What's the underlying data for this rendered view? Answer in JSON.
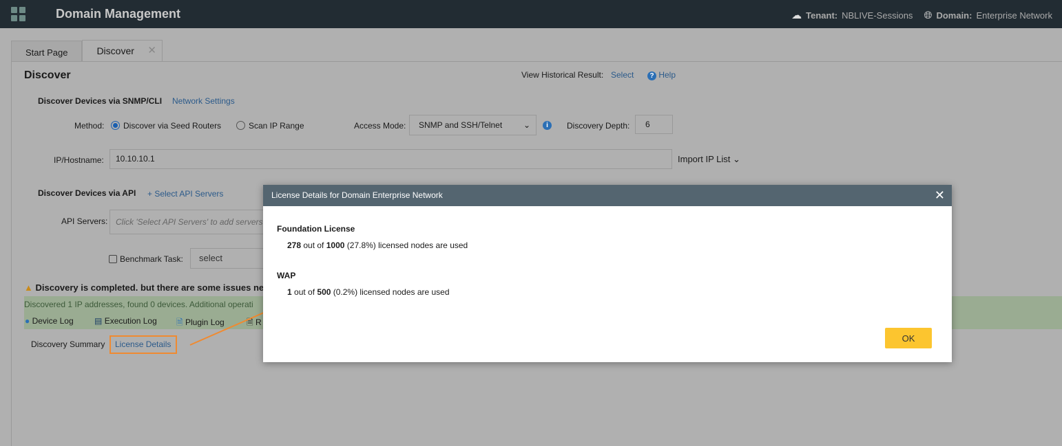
{
  "header": {
    "title": "Domain Management",
    "tenant_label": "Tenant:",
    "tenant": "NBLIVE-Sessions",
    "domain_label": "Domain:",
    "domain": "Enterprise Network"
  },
  "tabs": [
    {
      "label": "Start Page"
    },
    {
      "label": "Discover"
    }
  ],
  "page": {
    "title": "Discover",
    "view_hist": "View Historical Result:",
    "select": "Select",
    "help": "Help"
  },
  "snmp": {
    "title": "Discover Devices via SNMP/CLI",
    "network_settings": "Network Settings",
    "method_label": "Method:",
    "opt1": "Discover via Seed Routers",
    "opt2": "Scan IP Range",
    "access_label": "Access Mode:",
    "access_value": "SNMP and SSH/Telnet",
    "depth_label": "Discovery Depth:",
    "depth_value": "6",
    "ip_label": "IP/Hostname:",
    "ip_value": "10.10.10.1",
    "import": "Import IP List"
  },
  "api": {
    "title": "Discover Devices via API",
    "select_servers": "+ Select API Servers",
    "servers_label": "API Servers:",
    "servers_placeholder": "Click 'Select API Servers' to add servers.",
    "benchmark_label": "Benchmark Task:",
    "benchmark_value": "select"
  },
  "status": {
    "warning": "Discovery is completed. but there are some issues need",
    "summary": "Discovered 1 IP addresses, found 0 devices.  Additional operati",
    "logs": [
      "Device Log",
      "Execution Log",
      "Plugin Log",
      "R"
    ],
    "discovery_summary": "Discovery Summary",
    "license_details": "License Details"
  },
  "modal": {
    "title": "License Details for Domain Enterprise Network",
    "sections": [
      {
        "name": "Foundation License",
        "used": "278",
        "mid": " out of ",
        "total": "1000",
        "rest": " (27.8%) licensed nodes are used"
      },
      {
        "name": "WAP",
        "used": "1",
        "mid": " out of ",
        "total": "500",
        "rest": " (0.2%) licensed nodes are used"
      }
    ],
    "ok": "OK"
  },
  "colors": {
    "header": "#222c33",
    "modal_header": "#546570",
    "ok": "#fcc52f",
    "highlight": "#f08a30"
  }
}
